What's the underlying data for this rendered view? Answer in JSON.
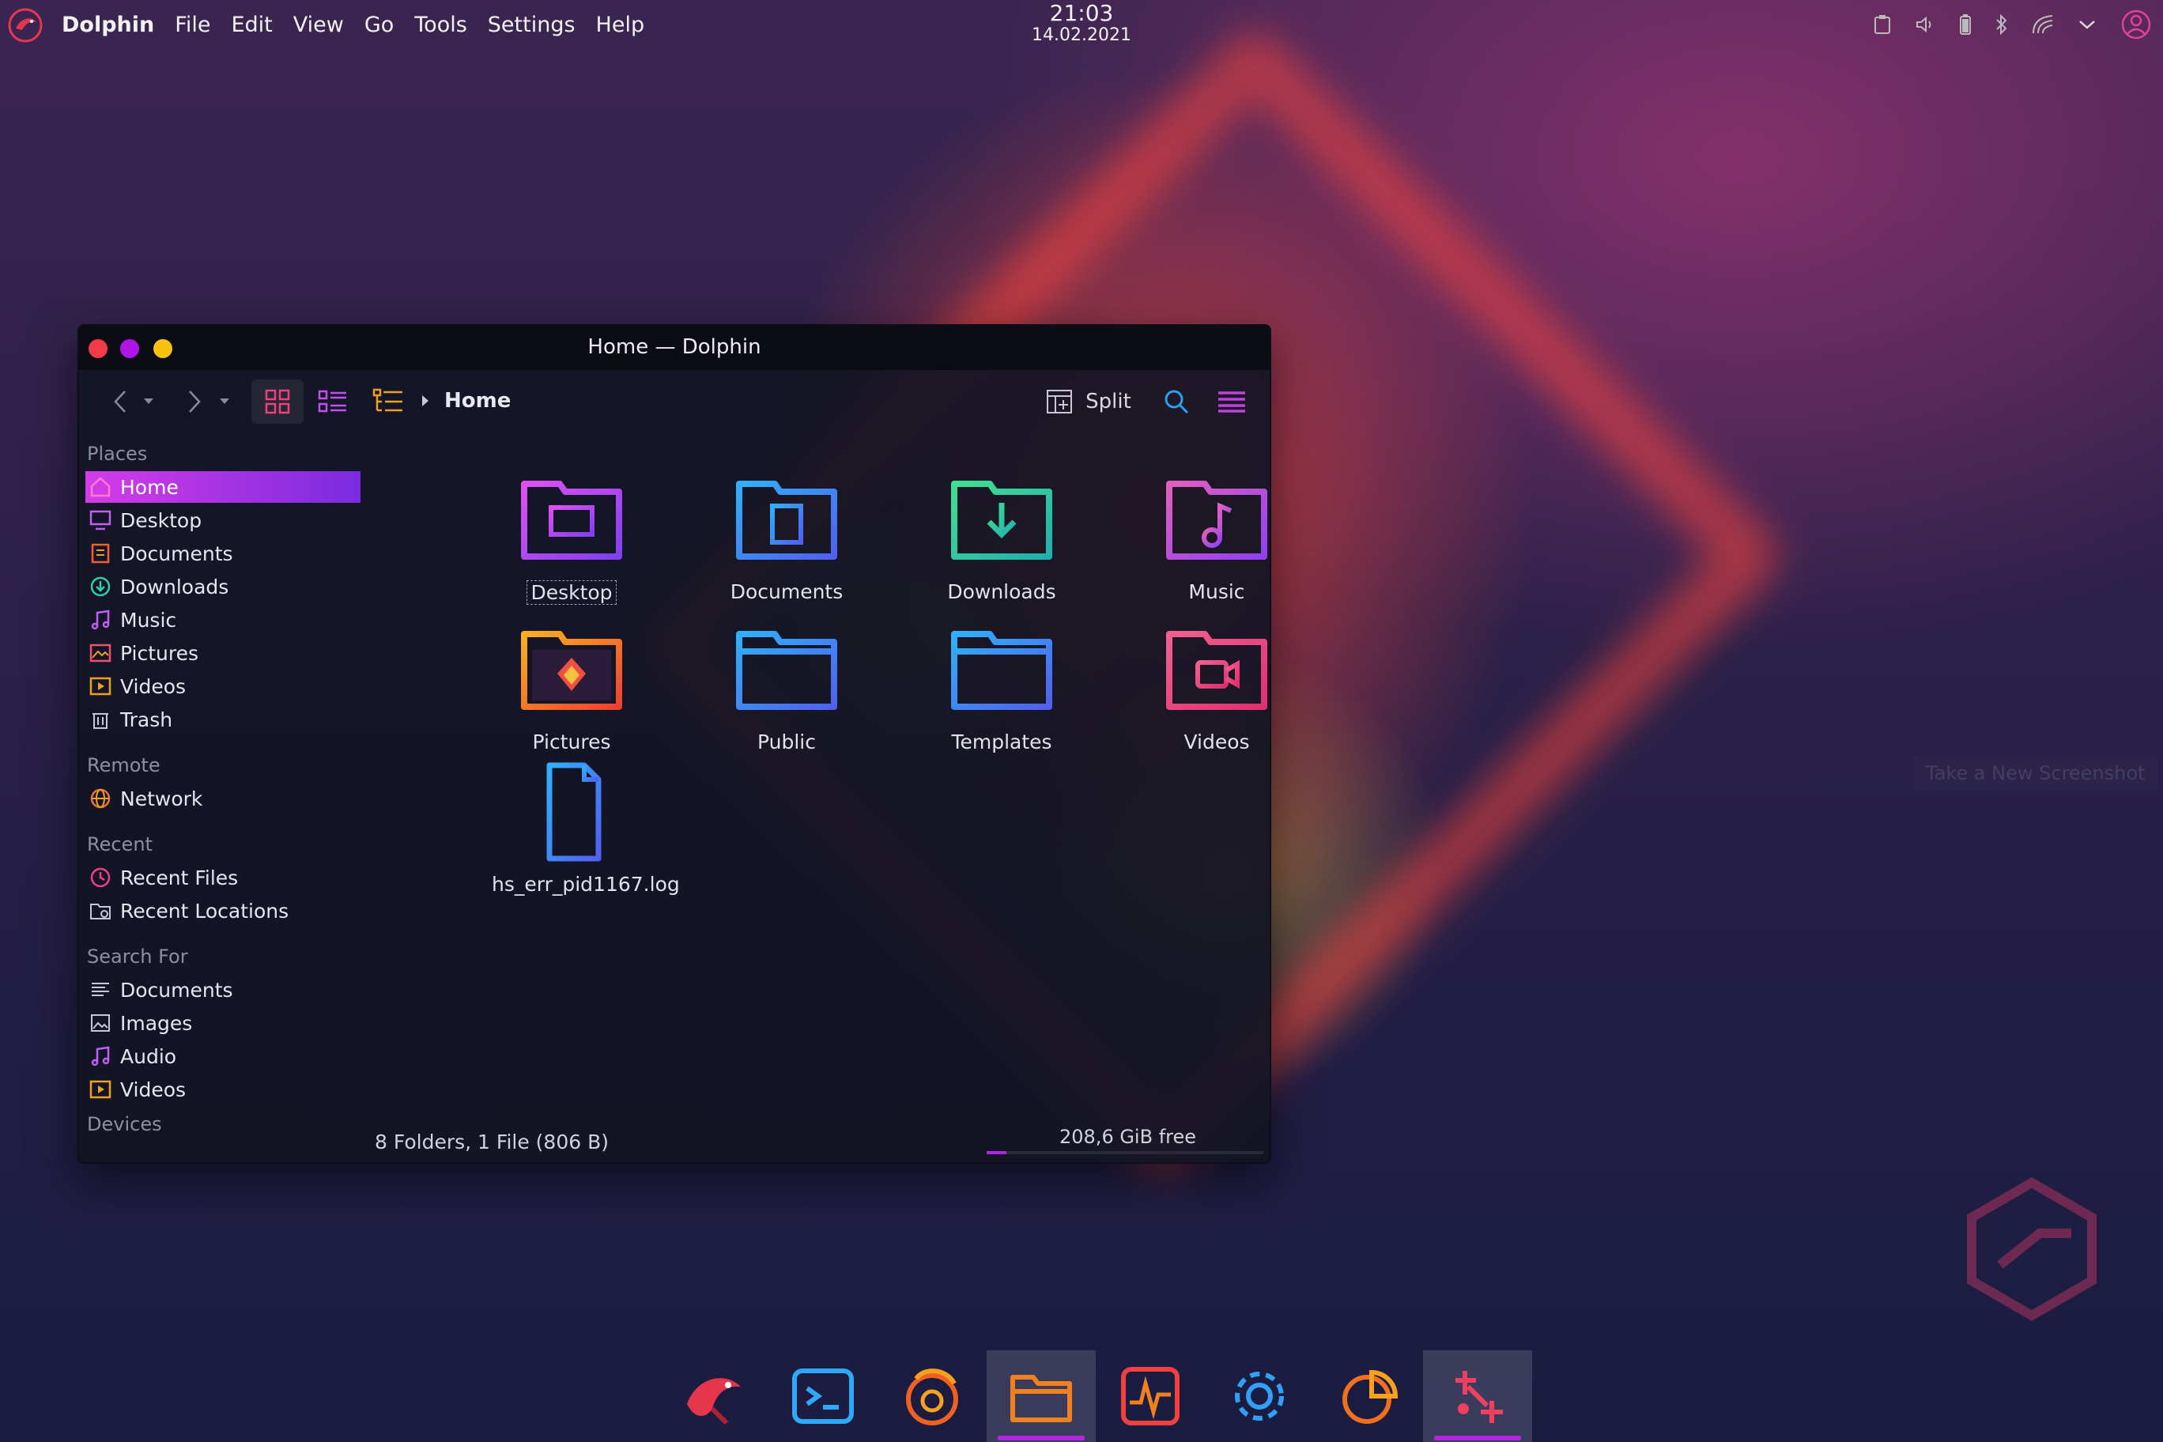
{
  "panel": {
    "app_name": "Dolphin",
    "menus": [
      "File",
      "Edit",
      "View",
      "Go",
      "Tools",
      "Settings",
      "Help"
    ],
    "time": "21:03",
    "date": "14.02.2021",
    "tray_icons": [
      "clipboard-icon",
      "volume-icon",
      "battery-icon",
      "bluetooth-icon",
      "network-icon",
      "chevron-down-icon",
      "user-icon"
    ]
  },
  "window": {
    "title": "Home — Dolphin",
    "breadcrumb": "Home",
    "split_label": "Split",
    "status": "8 Folders, 1 File (806 B)",
    "free_space": "208,6 GiB free",
    "free_fraction": 0.07
  },
  "sidebar": {
    "places_heading": "Places",
    "places": [
      "Home",
      "Desktop",
      "Documents",
      "Downloads",
      "Music",
      "Pictures",
      "Videos",
      "Trash"
    ],
    "remote_heading": "Remote",
    "remote": [
      "Network"
    ],
    "recent_heading": "Recent",
    "recent": [
      "Recent Files",
      "Recent Locations"
    ],
    "search_heading": "Search For",
    "search": [
      "Documents",
      "Images",
      "Audio",
      "Videos"
    ],
    "devices_heading": "Devices"
  },
  "files": [
    "Desktop",
    "Documents",
    "Downloads",
    "Music",
    "Pictures",
    "Public",
    "Templates",
    "Videos",
    "hs_err_pid1167.log"
  ],
  "ghost": "Take a New Screenshot",
  "dock": [
    "garuda-icon",
    "terminal-icon",
    "firefox-icon",
    "file-manager-icon",
    "system-monitor-icon",
    "settings-icon",
    "disk-usage-icon",
    "screenshot-icon"
  ],
  "colors": {
    "accent": "#b425e0",
    "close": "#f23a4b",
    "minimize": "#b014e6",
    "maximize": "#f8c20e"
  }
}
